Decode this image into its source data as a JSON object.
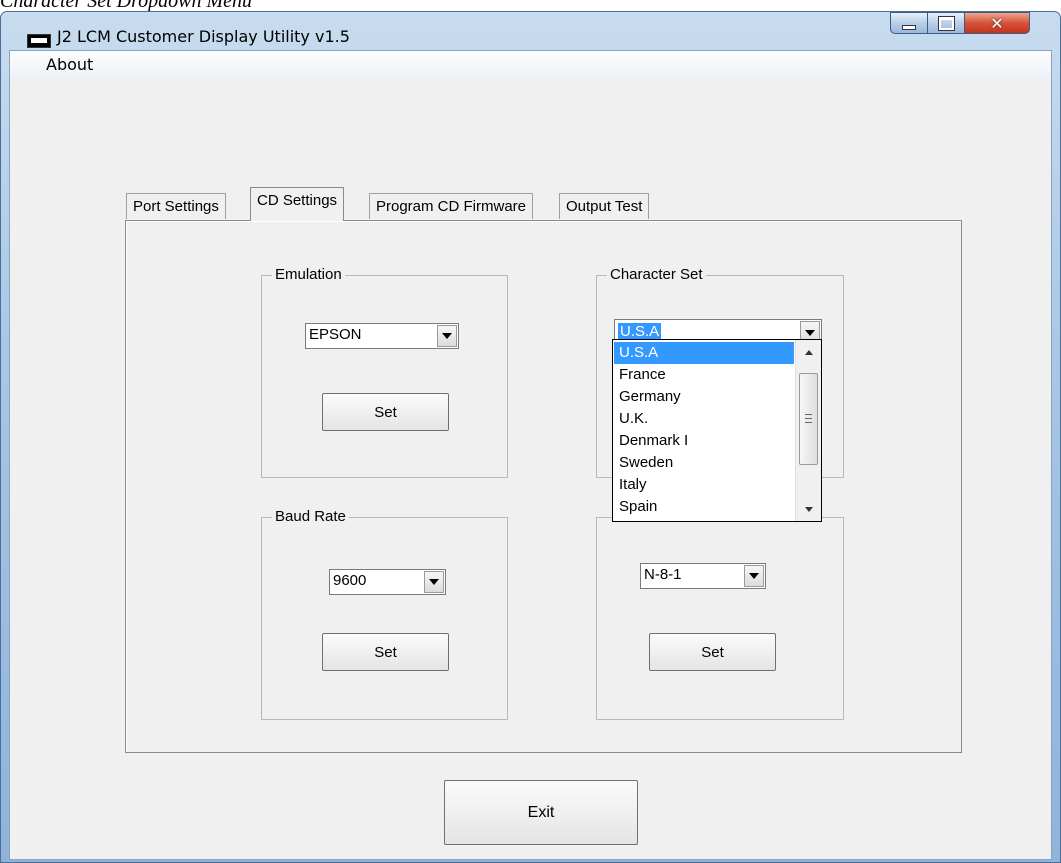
{
  "caption": "Character Set Dropdown Menu",
  "window": {
    "title": "J2 LCM Customer Display Utility v1.5"
  },
  "menu": {
    "about": "About"
  },
  "tabs": [
    {
      "label": "Port Settings",
      "active": false
    },
    {
      "label": "CD Settings",
      "active": true
    },
    {
      "label": "Program CD Firmware",
      "active": false
    },
    {
      "label": "Output Test",
      "active": false
    }
  ],
  "emulation": {
    "label": "Emulation",
    "value": "EPSON",
    "set_label": "Set"
  },
  "character_set": {
    "label": "Character Set",
    "value": "U.S.A",
    "options": [
      "U.S.A",
      "France",
      "Germany",
      "U.K.",
      "Denmark I",
      "Sweden",
      "Italy",
      "Spain"
    ],
    "selected_index": 0
  },
  "baud_rate": {
    "label": "Baud Rate",
    "value": "9600",
    "set_label": "Set"
  },
  "parity": {
    "value": "N-8-1",
    "set_label": "Set"
  },
  "exit_label": "Exit",
  "colors": {
    "selection": "#3399ff",
    "close_button": "#c2331b"
  }
}
